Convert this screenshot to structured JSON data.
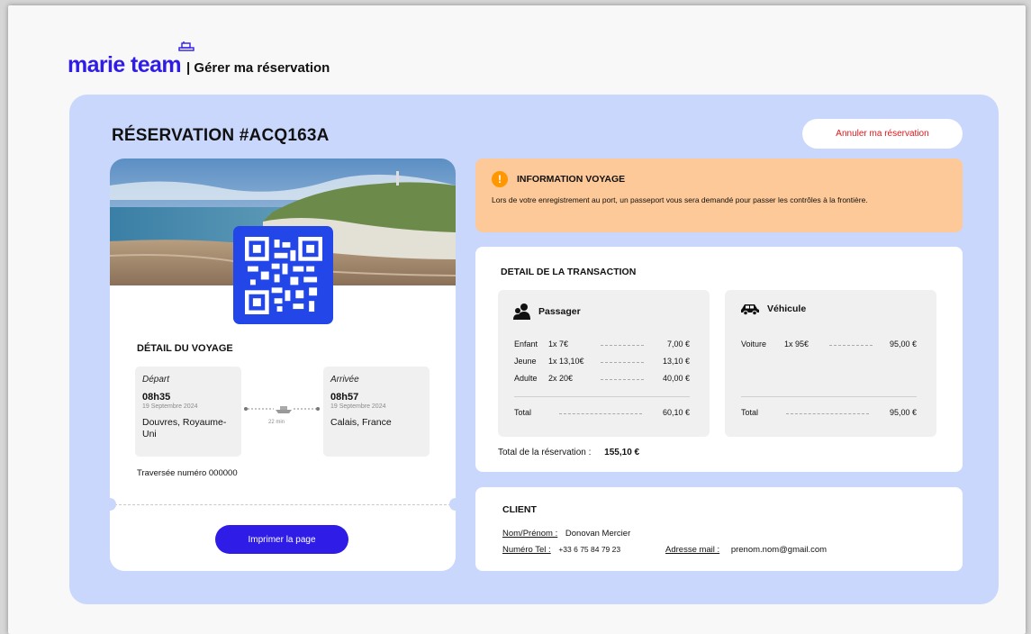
{
  "brand": {
    "logo": "marie team",
    "separator": "| Gérer ma réservation"
  },
  "reservation": {
    "title": "RÉSERVATION #ACQ163A",
    "cancel_label": "Annuler ma réservation"
  },
  "ticket": {
    "section_title": "DÉTAIL DU VOYAGE",
    "departure": {
      "label": "Départ",
      "time": "08h35",
      "date": "19 Septembre 2024",
      "city": "Douvres, Royaume-Uni"
    },
    "arrival": {
      "label": "Arrivée",
      "time": "08h57",
      "date": "19 Septembre 2024",
      "city": "Calais, France"
    },
    "duration": "22 min",
    "crossing": "Traversée numéro 000000",
    "print_label": "Imprimer la page"
  },
  "info": {
    "title": "INFORMATION VOYAGE",
    "text": "Lors de votre enregistrement au port, un passeport vous sera demandé pour passer les contrôles à la frontière."
  },
  "transaction": {
    "title": "DETAIL DE LA TRANSACTION",
    "passenger": {
      "title": "Passager",
      "rows": [
        {
          "name": "Enfant",
          "qty": "1x 7€",
          "amount": "7,00 €"
        },
        {
          "name": "Jeune",
          "qty": "1x 13,10€",
          "amount": "13,10 €"
        },
        {
          "name": "Adulte",
          "qty": "2x 20€",
          "amount": "40,00 €"
        }
      ],
      "total_label": "Total",
      "total": "60,10 €"
    },
    "vehicle": {
      "title": "Véhicule",
      "rows": [
        {
          "name": "Voiture",
          "qty": "1x 95€",
          "amount": "95,00 €"
        }
      ],
      "total_label": "Total",
      "total": "95,00 €"
    },
    "grand_label": "Total de la réservation :",
    "grand_total": "155,10 €"
  },
  "client": {
    "title": "CLIENT",
    "name_label": "Nom/Prénom :",
    "name": "Donovan Mercier",
    "phone_label": "Numéro Tel :",
    "phone": "+33 6 75 84 79 23",
    "email_label": "Adresse mail :",
    "email": "prenom.nom@gmail.com"
  },
  "colors": {
    "brand": "#2f1ce6",
    "card_bg": "#c9d7fd",
    "warning_bg": "#fdc998",
    "cancel_text": "#e0161b"
  },
  "icons": [
    "ship-icon",
    "qr-code-icon",
    "warning-icon",
    "passenger-icon",
    "car-icon",
    "ferry-route-icon"
  ]
}
